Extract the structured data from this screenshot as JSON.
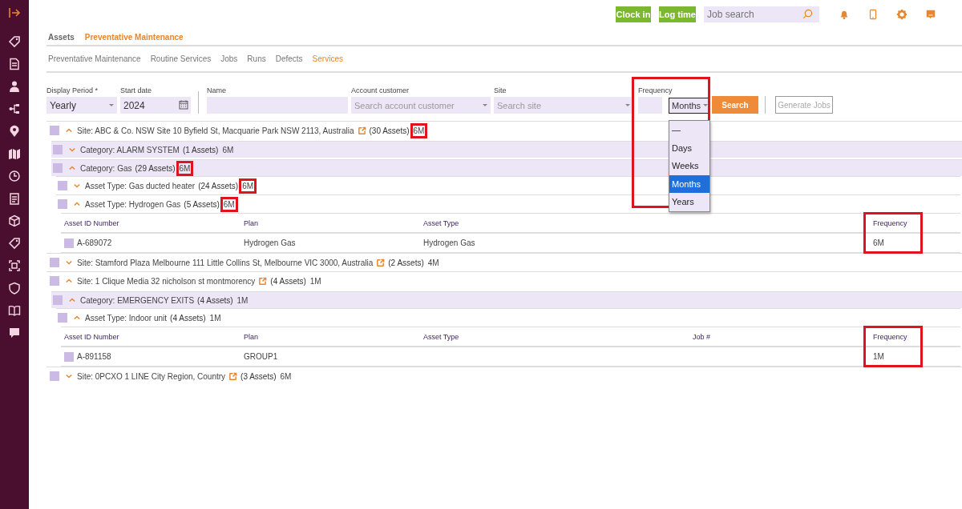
{
  "topbar": {
    "buttons": [
      {
        "label": "Clock in"
      },
      {
        "label": "Log time"
      }
    ],
    "search": {
      "placeholder": "Job search"
    }
  },
  "breadcrumb": [
    {
      "label": "Assets",
      "selected": false
    },
    {
      "label": "Preventative Maintenance",
      "selected": true
    }
  ],
  "tabs": [
    {
      "label": "Preventative Maintenance",
      "selected": false
    },
    {
      "label": "Routine Services",
      "selected": false
    },
    {
      "label": "Jobs",
      "selected": false
    },
    {
      "label": "Runs",
      "selected": false
    },
    {
      "label": "Defects",
      "selected": false
    },
    {
      "label": "Services",
      "selected": true
    }
  ],
  "filters": {
    "display_period": {
      "label": "Display Period *",
      "value": "Yearly"
    },
    "start_date": {
      "label": "Start date",
      "value": "2024"
    },
    "name": {
      "label": "Name"
    },
    "account_customer": {
      "label": "Account customer",
      "placeholder": "Search account customer"
    },
    "site": {
      "label": "Site",
      "placeholder": "Search site"
    },
    "frequency": {
      "label": "Frequency",
      "value": "Months",
      "highlighted": true,
      "options": [
        {
          "label": "—",
          "selected": false
        },
        {
          "label": "Days",
          "selected": false
        },
        {
          "label": "Weeks",
          "selected": false
        },
        {
          "label": "Months",
          "selected": true
        },
        {
          "label": "Years",
          "selected": false
        }
      ]
    },
    "buttons": [
      {
        "label": "Search",
        "disabled": false
      },
      {
        "label": "Generate Jobs",
        "disabled": true
      }
    ]
  },
  "tree": [
    {
      "kind": "site",
      "label": "Site: ABC & Co. NSW Site 10 Byfield St, Macquarie Park NSW 2113, Australia",
      "link": true,
      "count": "(30 Assets)",
      "frequency": "6M",
      "freq_highlighted": true,
      "checked": false,
      "expanded": true,
      "children": [
        {
          "kind": "category",
          "label": "Category: ALARM SYSTEM",
          "count": "(1 Assets)",
          "frequency": "6M",
          "freq_highlighted": false,
          "checked": false,
          "expanded": false
        },
        {
          "kind": "category",
          "label": "Category: Gas",
          "count": "(29 Assets)",
          "frequency": "6M",
          "freq_highlighted": true,
          "checked": false,
          "expanded": true,
          "children": [
            {
              "kind": "asset_type",
              "label": "Asset Type: Gas ducted heater",
              "count": "(24 Assets)",
              "frequency": "6M",
              "freq_highlighted": true,
              "checked": false,
              "expanded": false
            },
            {
              "kind": "asset_type",
              "label": "Asset Type: Hydrogen Gas",
              "count": "(5 Assets)",
              "frequency": "6M",
              "freq_highlighted": true,
              "checked": false,
              "expanded": true,
              "table": {
                "columns": [
                  {
                    "header": "Asset ID Number"
                  },
                  {
                    "header": "Plan"
                  },
                  {
                    "header": "Asset Type"
                  },
                  {},
                  {
                    "header": "Frequency",
                    "highlighted": true
                  }
                ],
                "rows": [
                  {
                    "checked": false,
                    "cells": [
                      "A-689072",
                      "Hydrogen Gas",
                      "Hydrogen Gas",
                      null,
                      "6M"
                    ]
                  }
                ]
              }
            }
          ]
        }
      ]
    },
    {
      "kind": "site",
      "label": "Site: Stamford Plaza Melbourne 111 Little Collins St, Melbourne VIC 3000, Australia",
      "link": true,
      "count": "(2 Assets)",
      "frequency": "4M",
      "freq_highlighted": false,
      "checked": false,
      "expanded": false
    },
    {
      "kind": "site",
      "label": "Site: 1 Clique Media 32 nicholson st montmorency",
      "link": true,
      "count": "(4 Assets)",
      "frequency": "1M",
      "freq_highlighted": false,
      "checked": false,
      "expanded": true,
      "children": [
        {
          "kind": "category",
          "label": "Category: EMERGENCY EXITS",
          "count": "(4 Assets)",
          "frequency": "1M",
          "freq_highlighted": false,
          "checked": false,
          "expanded": true,
          "children": [
            {
              "kind": "asset_type",
              "label": "Asset Type: Indoor unit",
              "count": "(4 Assets)",
              "frequency": "1M",
              "freq_highlighted": false,
              "checked": false,
              "expanded": true,
              "table": {
                "columns": [
                  {
                    "header": "Asset ID Number"
                  },
                  {
                    "header": "Plan"
                  },
                  {
                    "header": "Asset Type"
                  },
                  {
                    "header": "Job #"
                  },
                  {
                    "header": "Frequency",
                    "highlighted": true
                  }
                ],
                "rows": [
                  {
                    "checked": false,
                    "cells": [
                      "A-891158",
                      "GROUP1",
                      null,
                      null,
                      "1M"
                    ]
                  }
                ]
              }
            }
          ]
        }
      ]
    },
    {
      "kind": "site",
      "label": "Site: 0PCXO 1 LINE City Region, Country",
      "link": true,
      "count": "(3 Assets)",
      "frequency": "6M",
      "freq_highlighted": false,
      "checked": false,
      "expanded": false
    }
  ]
}
